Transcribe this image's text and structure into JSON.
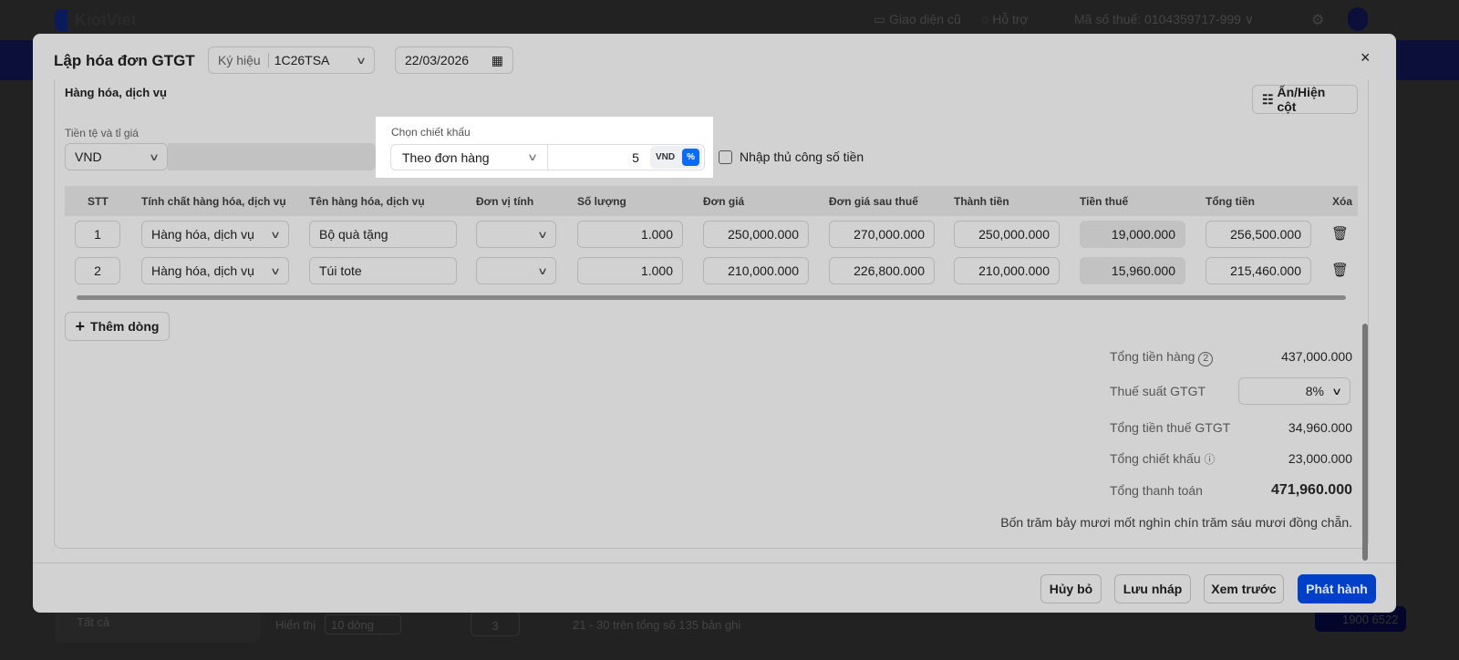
{
  "topbar": {
    "brand": "KiotViet",
    "old_ui": "Giao diện cũ",
    "support": "Hỗ trợ",
    "tax_label": "Mã số thuế:",
    "tax_code": "0104359717-999"
  },
  "background": {
    "filter": "Tất cả",
    "show_label": "Hiển thị",
    "page_size": "10 dòng",
    "page": "3",
    "range": "21 - 30 trên tổng số 135 bản ghi",
    "hotline": "1900 6522"
  },
  "modal": {
    "title": "Lập hóa đơn GTGT",
    "symbol_label": "Ký hiệu",
    "symbol": "1C26TSA",
    "date": "22/03/2026",
    "section": "Hàng hóa, dịch vụ",
    "toggle_columns": "Ấn/Hiện cột",
    "currency_label": "Tiền tệ và tỉ giá",
    "currency": "VND",
    "discount": {
      "label": "Chọn chiết khấu",
      "type": "Theo đơn hàng",
      "value": "5",
      "unit_vnd": "VND",
      "unit_pct": "%",
      "manual": "Nhập thủ công số tiền"
    },
    "columns": [
      "STT",
      "Tính chất hàng hóa, dịch vụ",
      "Tên hàng hóa, dịch vụ",
      "Đơn vị tính",
      "Số lượng",
      "Đơn giá",
      "Đơn giá sau thuế",
      "Thành tiền",
      "Tiền thuế",
      "Tổng tiền",
      "Xóa"
    ],
    "rows": [
      {
        "stt": "1",
        "nature": "Hàng hóa, dịch vụ",
        "name": "Bộ quà tặng",
        "unit": "",
        "qty": "1.000",
        "price": "250,000.000",
        "price_tax": "270,000.000",
        "amount": "250,000.000",
        "tax": "19,000.000",
        "total": "256,500.000"
      },
      {
        "stt": "2",
        "nature": "Hàng hóa, dịch vụ",
        "name": "Túi tote",
        "unit": "",
        "qty": "1.000",
        "price": "210,000.000",
        "price_tax": "226,800.000",
        "amount": "210,000.000",
        "tax": "15,960.000",
        "total": "215,460.000"
      }
    ],
    "add_row": "Thêm dòng",
    "summary": {
      "goods_label": "Tổng tiền hàng",
      "goods_badge": "2",
      "goods": "437,000.000",
      "vat_rate_label": "Thuế suất GTGT",
      "vat_rate": "8%",
      "vat_label": "Tổng tiền thuế GTGT",
      "vat": "34,960.000",
      "discount_label": "Tổng chiết khấu",
      "discount": "23,000.000",
      "pay_label": "Tổng thanh toán",
      "pay": "471,960.000",
      "in_words": "Bốn trăm bảy mươi mốt nghìn chín trăm sáu mươi đồng chẵn."
    },
    "buttons": {
      "cancel": "Hủy bỏ",
      "draft": "Lưu nháp",
      "preview": "Xem trước",
      "issue": "Phát hành"
    }
  }
}
